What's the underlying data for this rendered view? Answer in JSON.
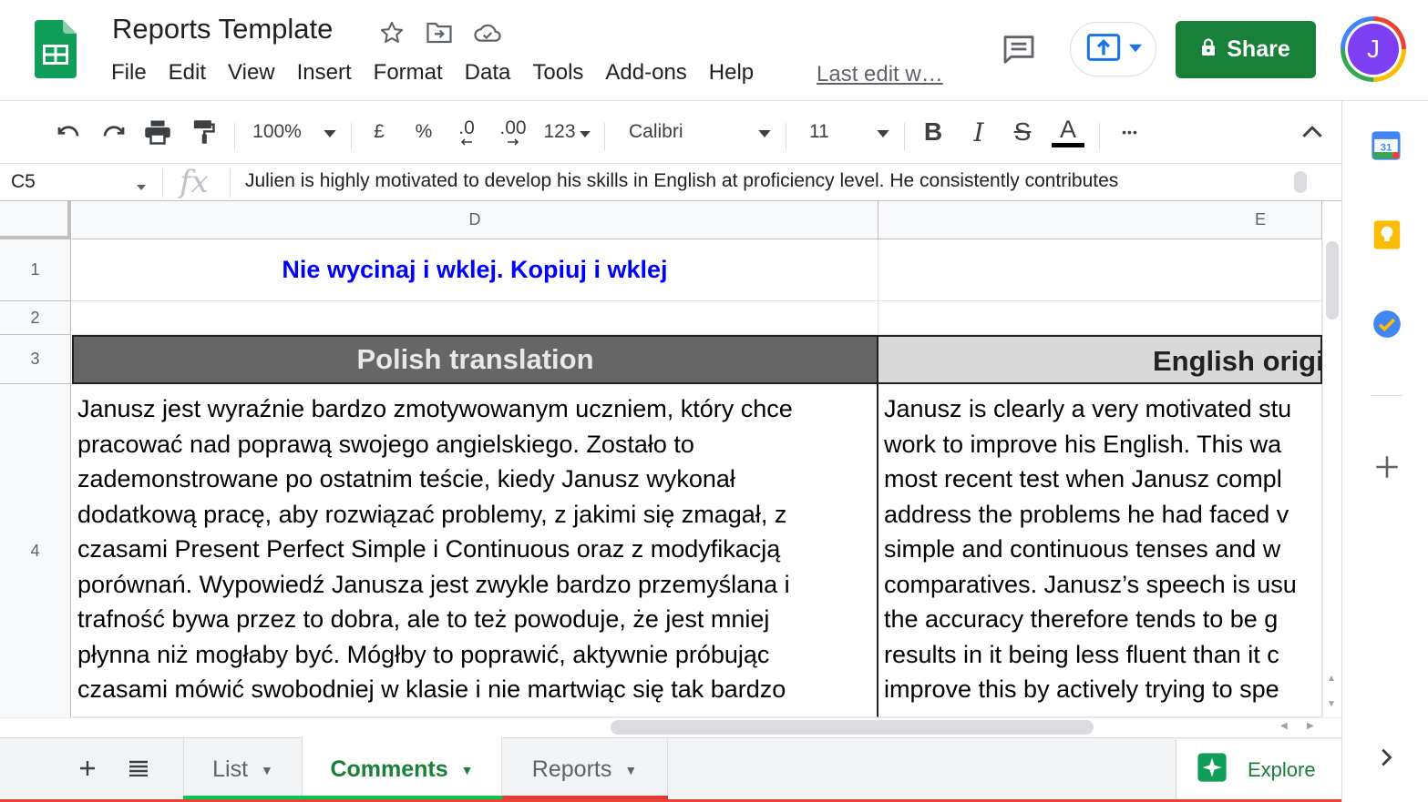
{
  "document": {
    "title": "Reports Template"
  },
  "menu": [
    "File",
    "Edit",
    "View",
    "Insert",
    "Format",
    "Data",
    "Tools",
    "Add-ons",
    "Help"
  ],
  "last_edit": "Last edit w…",
  "share_label": "Share",
  "avatar_letter": "J",
  "toolbar": {
    "zoom": "100%",
    "currency": "£",
    "percent": "%",
    "decrease_decimals": ".0",
    "increase_decimals": ".00",
    "more_formats": "123",
    "font": "Calibri",
    "font_size": "11",
    "bold": "B",
    "italic": "I",
    "strike": "S",
    "text_color": "A",
    "more": "•••"
  },
  "formula_bar": {
    "cell_ref": "C5",
    "fx": "fx",
    "content": "Julien is highly motivated to develop his skills in English at proficiency level.  He consistently contributes"
  },
  "columns": [
    "D",
    "E"
  ],
  "rows": [
    "1",
    "2",
    "3",
    "4"
  ],
  "cells": {
    "d1": "Nie wycinaj i wklej. Kopiuj i wklej",
    "d3": "Polish translation",
    "e3": "English original",
    "d4": [
      "Janusz jest wyraźnie bardzo zmotywowanym uczniem, który chce",
      "pracować nad poprawą swojego angielskiego. Zostało to",
      "zademonstrowane po ostatnim teście, kiedy Janusz wykonał",
      "dodatkową pracę, aby rozwiązać problemy, z jakimi się zmagał, z",
      "czasami Present Perfect Simple i Continuous oraz z modyfikacją",
      "porównań. Wypowiedź Janusza jest zwykle bardzo przemyślana i",
      "trafność bywa przez to dobra, ale to też powoduje, że jest mniej",
      "płynna niż mogłaby być. Mógłby to poprawić, aktywnie próbując",
      "czasami mówić swobodniej w klasie i nie martwiąc się tak bardzo"
    ],
    "e4": [
      "Janusz is clearly a very motivated stu",
      "work to improve his English. This wa",
      "most recent test when Janusz compl",
      "address the problems he had faced v",
      "simple and continuous tenses and w",
      "comparatives. Janusz’s speech is usu",
      "the accuracy therefore tends to be g",
      "results in it being less fluent than it c",
      "improve this by actively trying to spe"
    ]
  },
  "sheet_tabs": [
    {
      "label": "List",
      "color": "#00c853",
      "active": false
    },
    {
      "label": "Comments",
      "color": "#00c853",
      "active": true
    },
    {
      "label": "Reports",
      "color": "#e53935",
      "active": false
    }
  ],
  "explore_label": "Explore",
  "calendar_day": "31",
  "colors": {
    "brand_green": "#188038",
    "header_blue": "#0000ff",
    "polish_header_bg": "#666666",
    "english_header_bg": "#d9d9d9"
  }
}
